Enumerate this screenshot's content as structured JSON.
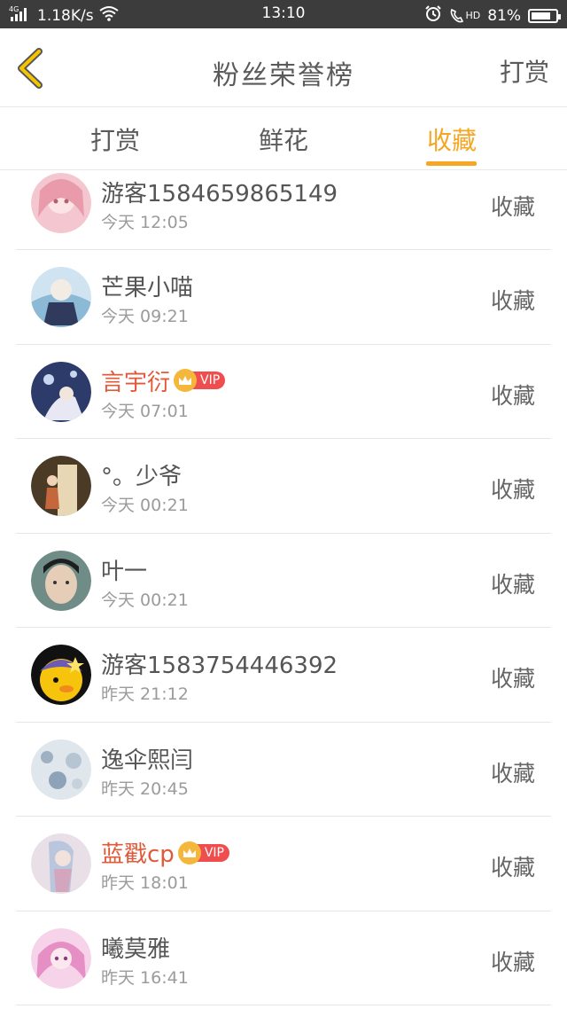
{
  "status_bar": {
    "network": "4G",
    "speed": "1.18K/s",
    "time": "13:10",
    "hd": "HD",
    "battery_percent": "81%",
    "battery_level": 0.81
  },
  "header": {
    "title": "粉丝荣誉榜",
    "action": "打赏"
  },
  "tabs": [
    {
      "label": "打赏",
      "active": false
    },
    {
      "label": "鲜花",
      "active": false
    },
    {
      "label": "收藏",
      "active": true
    }
  ],
  "vip_label": "VIP",
  "list": [
    {
      "name": "游客1584659865149",
      "time": "今天 12:05",
      "action": "收藏",
      "vip": false
    },
    {
      "name": "芒果小喵",
      "time": "今天 09:21",
      "action": "收藏",
      "vip": false
    },
    {
      "name": "言宇衍",
      "time": "今天 07:01",
      "action": "收藏",
      "vip": true
    },
    {
      "name": "°。少爷",
      "time": "今天 00:21",
      "action": "收藏",
      "vip": false
    },
    {
      "name": "叶一",
      "time": "今天 00:21",
      "action": "收藏",
      "vip": false
    },
    {
      "name": "游客1583754446392",
      "time": "昨天 21:12",
      "action": "收藏",
      "vip": false
    },
    {
      "name": "逸伞熙闫",
      "time": "昨天 20:45",
      "action": "收藏",
      "vip": false
    },
    {
      "name": "蓝戳cp",
      "time": "昨天 18:01",
      "action": "收藏",
      "vip": true
    },
    {
      "name": "曦莫雅",
      "time": "昨天 16:41",
      "action": "收藏",
      "vip": false
    }
  ],
  "colors": {
    "accent": "#f5a623",
    "vip_name": "#e05a3a",
    "status_bar_bg": "#3c3c3c"
  }
}
